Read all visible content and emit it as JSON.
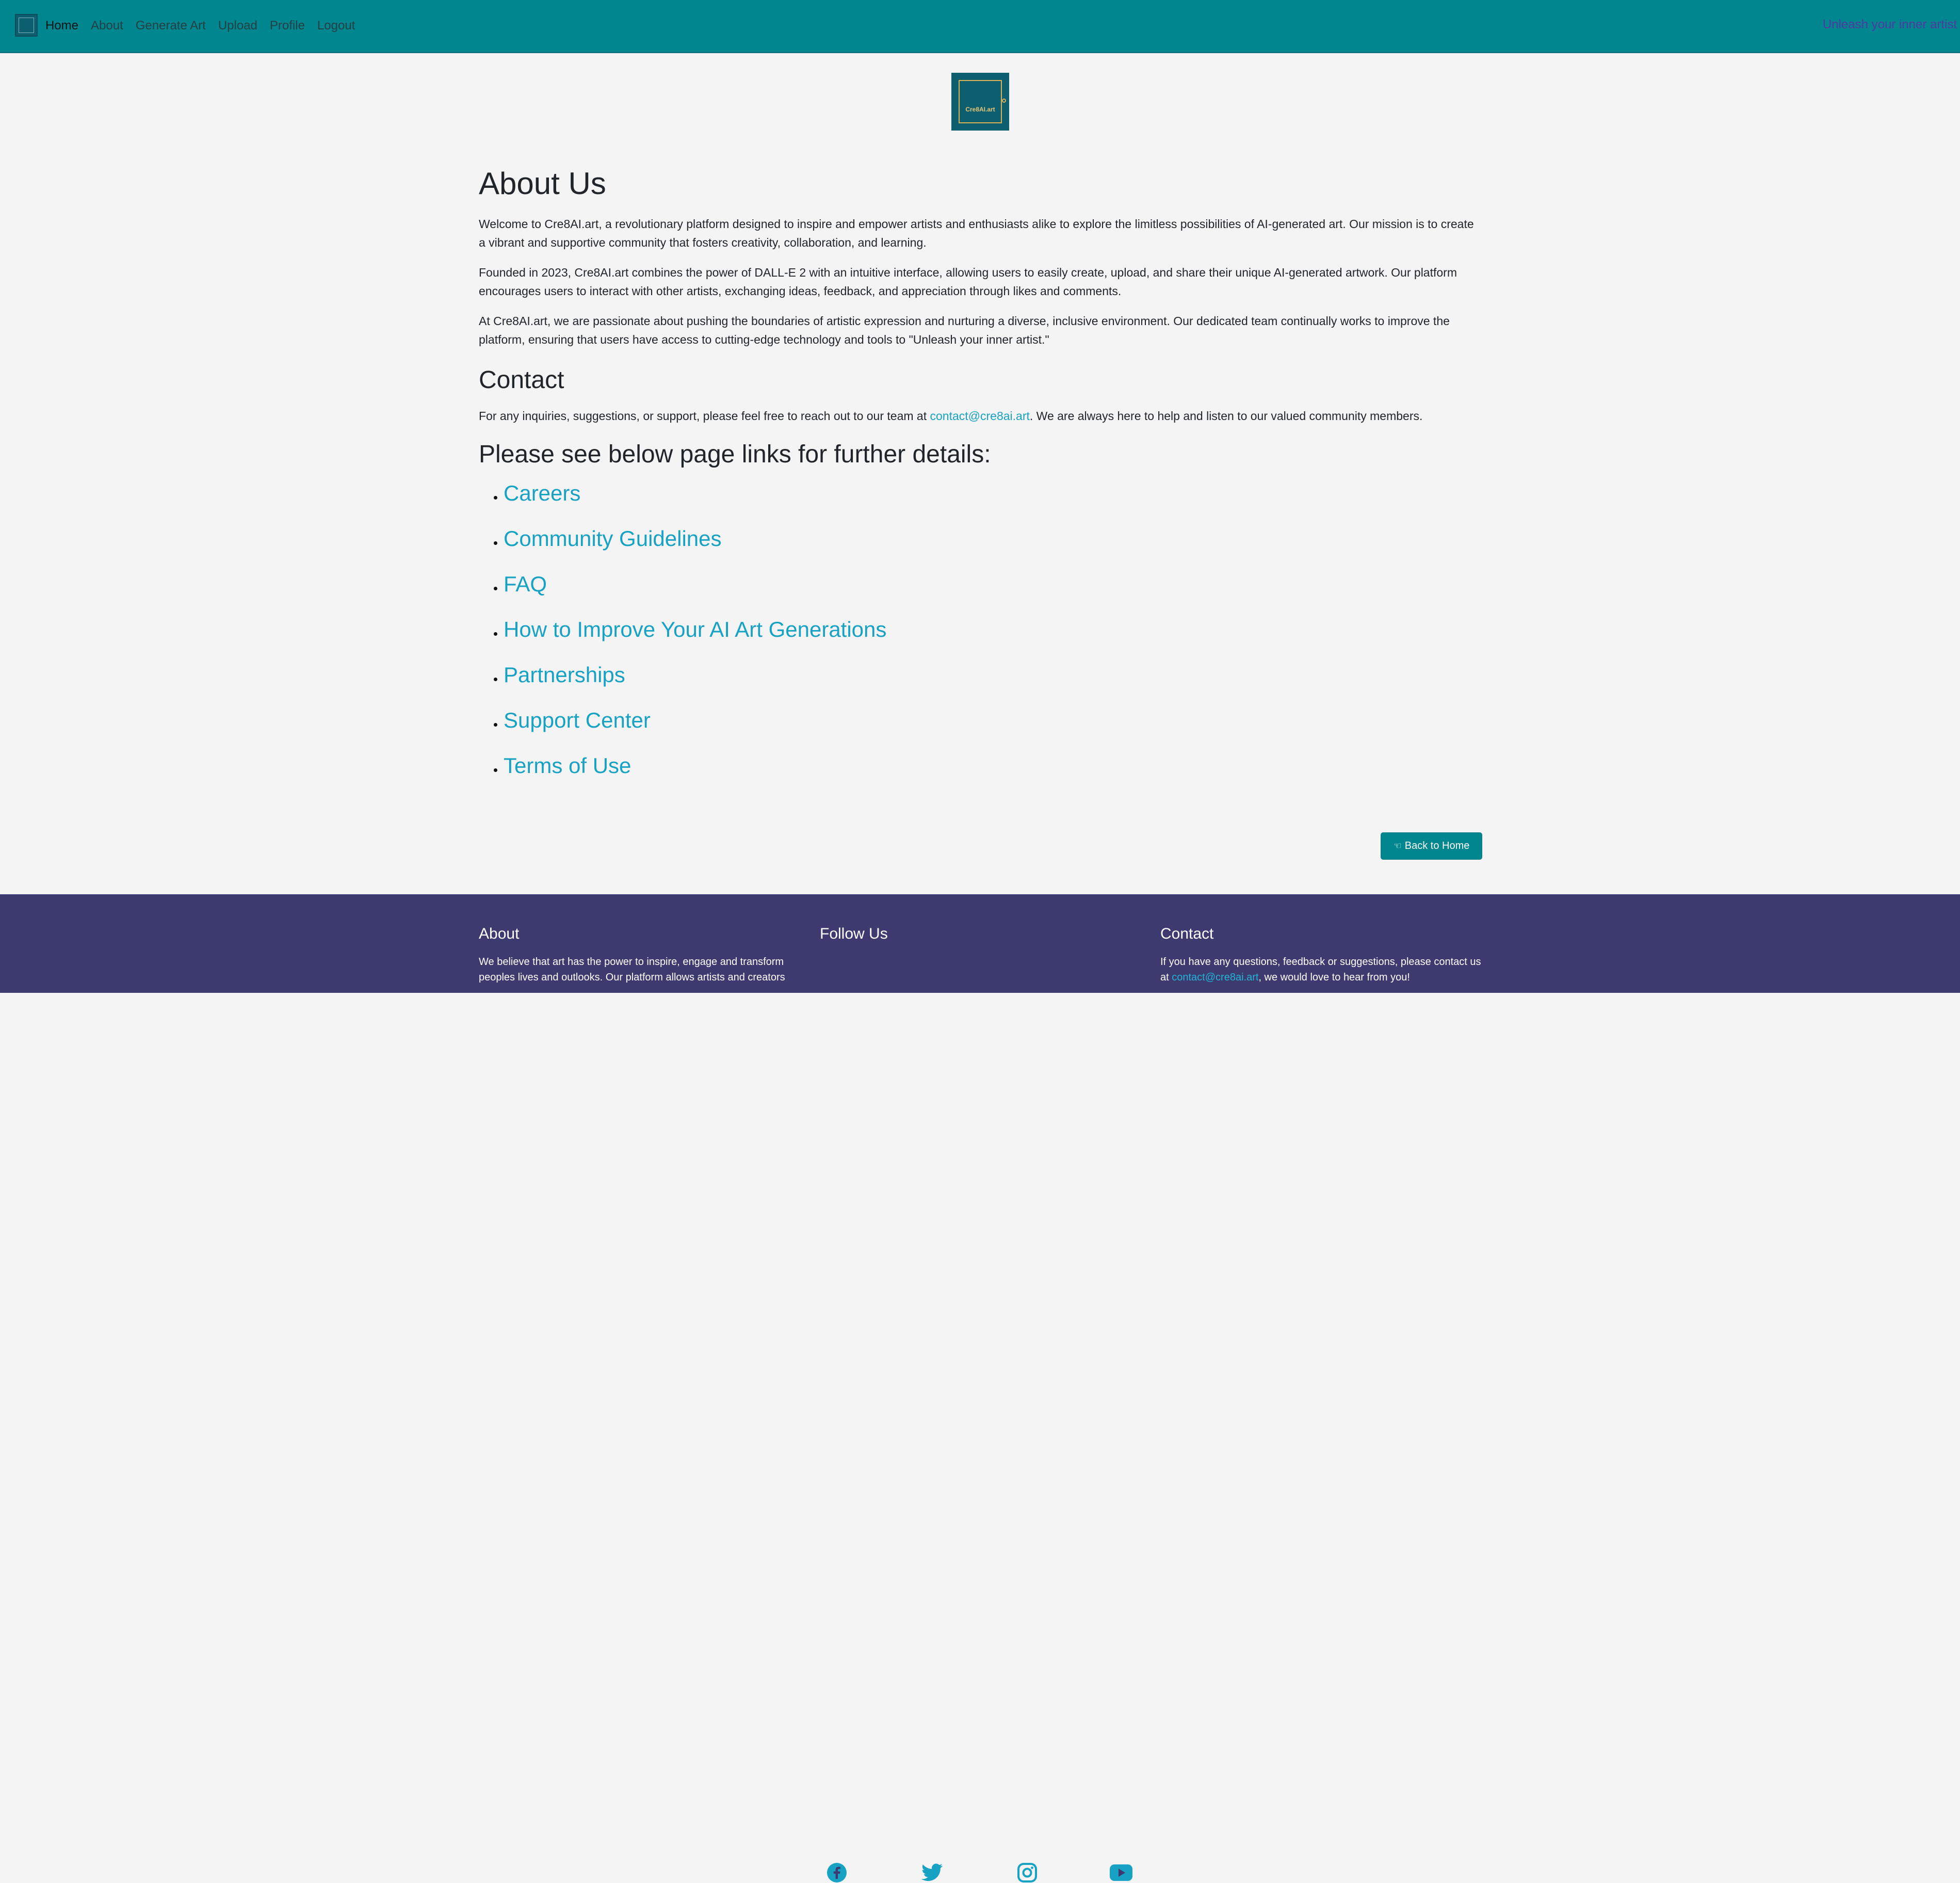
{
  "nav": {
    "items": [
      {
        "label": "Home"
      },
      {
        "label": "About"
      },
      {
        "label": "Generate Art"
      },
      {
        "label": "Upload"
      },
      {
        "label": "Profile"
      },
      {
        "label": "Logout"
      }
    ],
    "tagline": "Unleash your inner artist"
  },
  "logo": {
    "text": "Cre8AI.art"
  },
  "about": {
    "title": "About Us",
    "p1": "Welcome to Cre8AI.art, a revolutionary platform designed to inspire and empower artists and enthusiasts alike to explore the limitless possibilities of AI-generated art. Our mission is to create a vibrant and supportive community that fosters creativity, collaboration, and learning.",
    "p2": "Founded in 2023, Cre8AI.art combines the power of DALL-E 2 with an intuitive interface, allowing users to easily create, upload, and share their unique AI-generated artwork. Our platform encourages users to interact with other artists, exchanging ideas, feedback, and appreciation through likes and comments.",
    "p3": "At Cre8AI.art, we are passionate about pushing the boundaries of artistic expression and nurturing a diverse, inclusive environment. Our dedicated team continually works to improve the platform, ensuring that users have access to cutting-edge technology and tools to \"Unleash your inner artist.\""
  },
  "contact": {
    "title": "Contact",
    "before": "For any inquiries, suggestions, or support, please feel free to reach out to our team at ",
    "email": "contact@cre8ai.art",
    "after": ". We are always here to help and listen to our valued community members."
  },
  "further": {
    "title": "Please see below page links for further details:",
    "links": [
      "Careers",
      "Community Guidelines",
      "FAQ",
      "How to Improve Your AI Art Generations",
      "Partnerships",
      "Support Center",
      "Terms of Use"
    ]
  },
  "back_button": {
    "icon": "hand-pointing-left-icon",
    "label": "Back to Home"
  },
  "footer": {
    "about": {
      "title": "About",
      "text": "We believe that art has the power to inspire, engage and transform peoples lives and outlooks. Our platform allows artists and creators"
    },
    "follow": {
      "title": "Follow Us",
      "icons": [
        "facebook-icon",
        "twitter-icon",
        "instagram-icon",
        "youtube-icon"
      ]
    },
    "contact": {
      "title": "Contact",
      "before": "If you have any questions, feedback or suggestions, please contact us at ",
      "email": "contact@cre8ai.art",
      "after": ", we would love to hear from you!"
    }
  },
  "colors": {
    "navbar": "#00868f",
    "footer": "#3d3a70",
    "link": "#17a2c4",
    "tagline": "#503aa0"
  }
}
